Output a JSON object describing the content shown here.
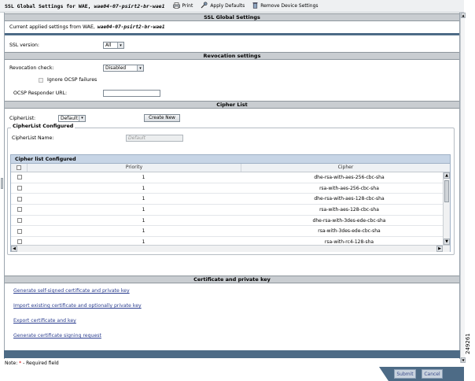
{
  "window": {
    "title_prefix": "SSL Global Settings for WAE,",
    "title_device": "wae04-07-psirt2-br-wae1",
    "actions": [
      {
        "label": "Print",
        "icon": "printer-icon"
      },
      {
        "label": "Apply Defaults",
        "icon": "apply-defaults-icon"
      },
      {
        "label": "Remove Device Settings",
        "icon": "trash-icon"
      }
    ]
  },
  "ssl_section": {
    "header": "SSL Global Settings",
    "current_text": "Current applied settings from WAE,",
    "current_device": "wae04-07-psirt2-br-wae1",
    "ssl_version_label": "SSL version:",
    "ssl_version_value": "All"
  },
  "revocation": {
    "header": "Revocation settings",
    "check_label": "Revocation check:",
    "check_value": "Disabled",
    "ignore_ocsp_label": "Ignore OCSP failures",
    "ocsp_url_label": "OCSP Responder URL:",
    "ocsp_url_value": ""
  },
  "cipher_list": {
    "header": "Cipher List",
    "cipherlist_label": "CipherList:",
    "cipherlist_value": "Default",
    "create_new_label": "Create New",
    "configured_legend": "CipherList Configured",
    "name_label": "CipherList Name:",
    "name_placeholder": "Default",
    "table_title": "Cipher list Configured",
    "columns": [
      "",
      "Priority",
      "Cipher"
    ],
    "rows": [
      {
        "priority": "1",
        "cipher": "dhe-rsa-with-aes-256-cbc-sha"
      },
      {
        "priority": "1",
        "cipher": "rsa-with-aes-256-cbc-sha"
      },
      {
        "priority": "1",
        "cipher": "dhe-rsa-with-aes-128-cbc-sha"
      },
      {
        "priority": "1",
        "cipher": "rsa-with-aes-128-cbc-sha"
      },
      {
        "priority": "1",
        "cipher": "dhe-rsa-with-3des-ede-cbc-sha"
      },
      {
        "priority": "1",
        "cipher": "rsa-with-3des-ede-cbc-sha"
      },
      {
        "priority": "1",
        "cipher": "rsa-with-rc4-128-sha"
      }
    ]
  },
  "certificate": {
    "header": "Certificate and private key",
    "links": [
      "Generate self-signed certificate and private key",
      "Import existing certificate and optionally private key",
      "Export certificate and key",
      "Generate certificate signing request"
    ]
  },
  "footer": {
    "note_prefix": "Note:",
    "required_mark": "*",
    "note_suffix": "- Required field",
    "submit_label": "Submit",
    "cancel_label": "Cancel",
    "figure_number": "249261"
  }
}
